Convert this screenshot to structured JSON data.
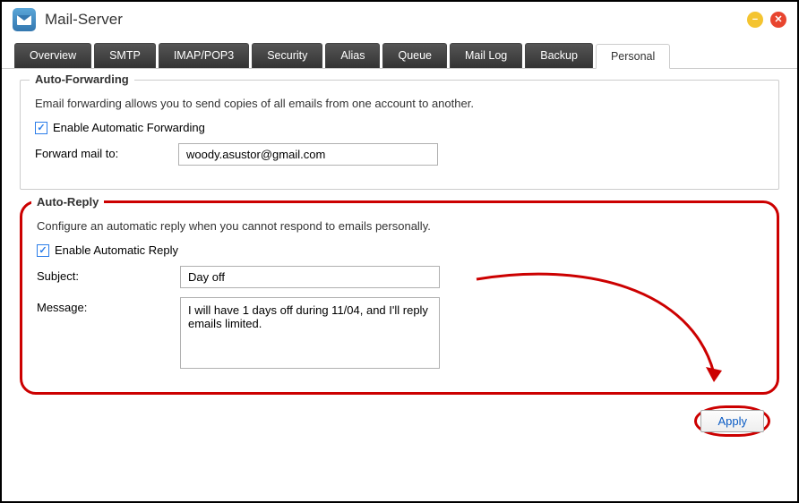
{
  "window": {
    "title": "Mail-Server"
  },
  "tabs": [
    "Overview",
    "SMTP",
    "IMAP/POP3",
    "Security",
    "Alias",
    "Queue",
    "Mail Log",
    "Backup",
    "Personal"
  ],
  "activeTab": "Personal",
  "autoForward": {
    "legend": "Auto-Forwarding",
    "desc": "Email forwarding allows you to send copies of all emails from one account to another.",
    "enableLabel": "Enable Automatic Forwarding",
    "forwardToLabel": "Forward mail to:",
    "forwardToValue": "woody.asustor@gmail.com"
  },
  "autoReply": {
    "legend": "Auto-Reply",
    "desc": "Configure an automatic reply when you cannot respond to emails personally.",
    "enableLabel": "Enable Automatic Reply",
    "subjectLabel": "Subject:",
    "subjectValue": "Day off",
    "messageLabel": "Message:",
    "messageValue": "I will have 1 days off during 11/04, and I'll reply emails limited."
  },
  "buttons": {
    "apply": "Apply"
  }
}
